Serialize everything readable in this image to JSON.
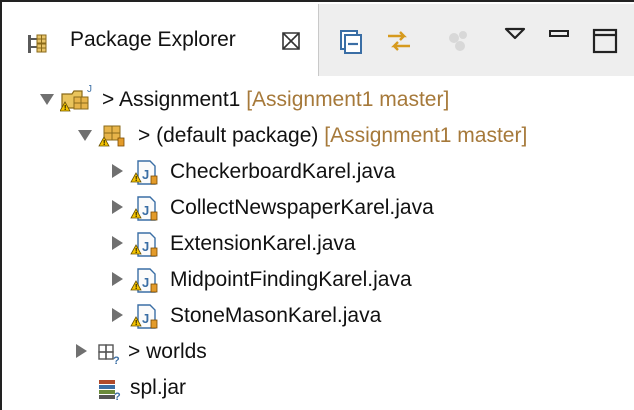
{
  "view": {
    "title": "Package Explorer",
    "close_glyph": "⌧"
  },
  "toolbar": {
    "buttons": [
      {
        "name": "collapse-all-icon"
      },
      {
        "name": "link-with-editor-icon"
      },
      {
        "name": "focus-on-active-task-icon"
      },
      {
        "name": "view-menu-icon"
      },
      {
        "name": "minimize-icon"
      },
      {
        "name": "maximize-icon"
      }
    ]
  },
  "tree": {
    "project": {
      "prefix": ">",
      "name": "Assignment1",
      "decoration": "[Assignment1 master]",
      "expanded": true
    },
    "package": {
      "prefix": ">",
      "name": "(default package)",
      "decoration": "[Assignment1 master]",
      "expanded": true
    },
    "files": [
      "CheckerboardKarel.java",
      "CollectNewspaperKarel.java",
      "ExtensionKarel.java",
      "MidpointFindingKarel.java",
      "StoneMasonKarel.java"
    ],
    "folder": {
      "prefix": ">",
      "name": "worlds",
      "expanded": false
    },
    "jar": {
      "name": "spl.jar"
    }
  },
  "colors": {
    "decoration": "#a6793a",
    "header_bg": "#eeeeee",
    "arrow": "#707070"
  }
}
